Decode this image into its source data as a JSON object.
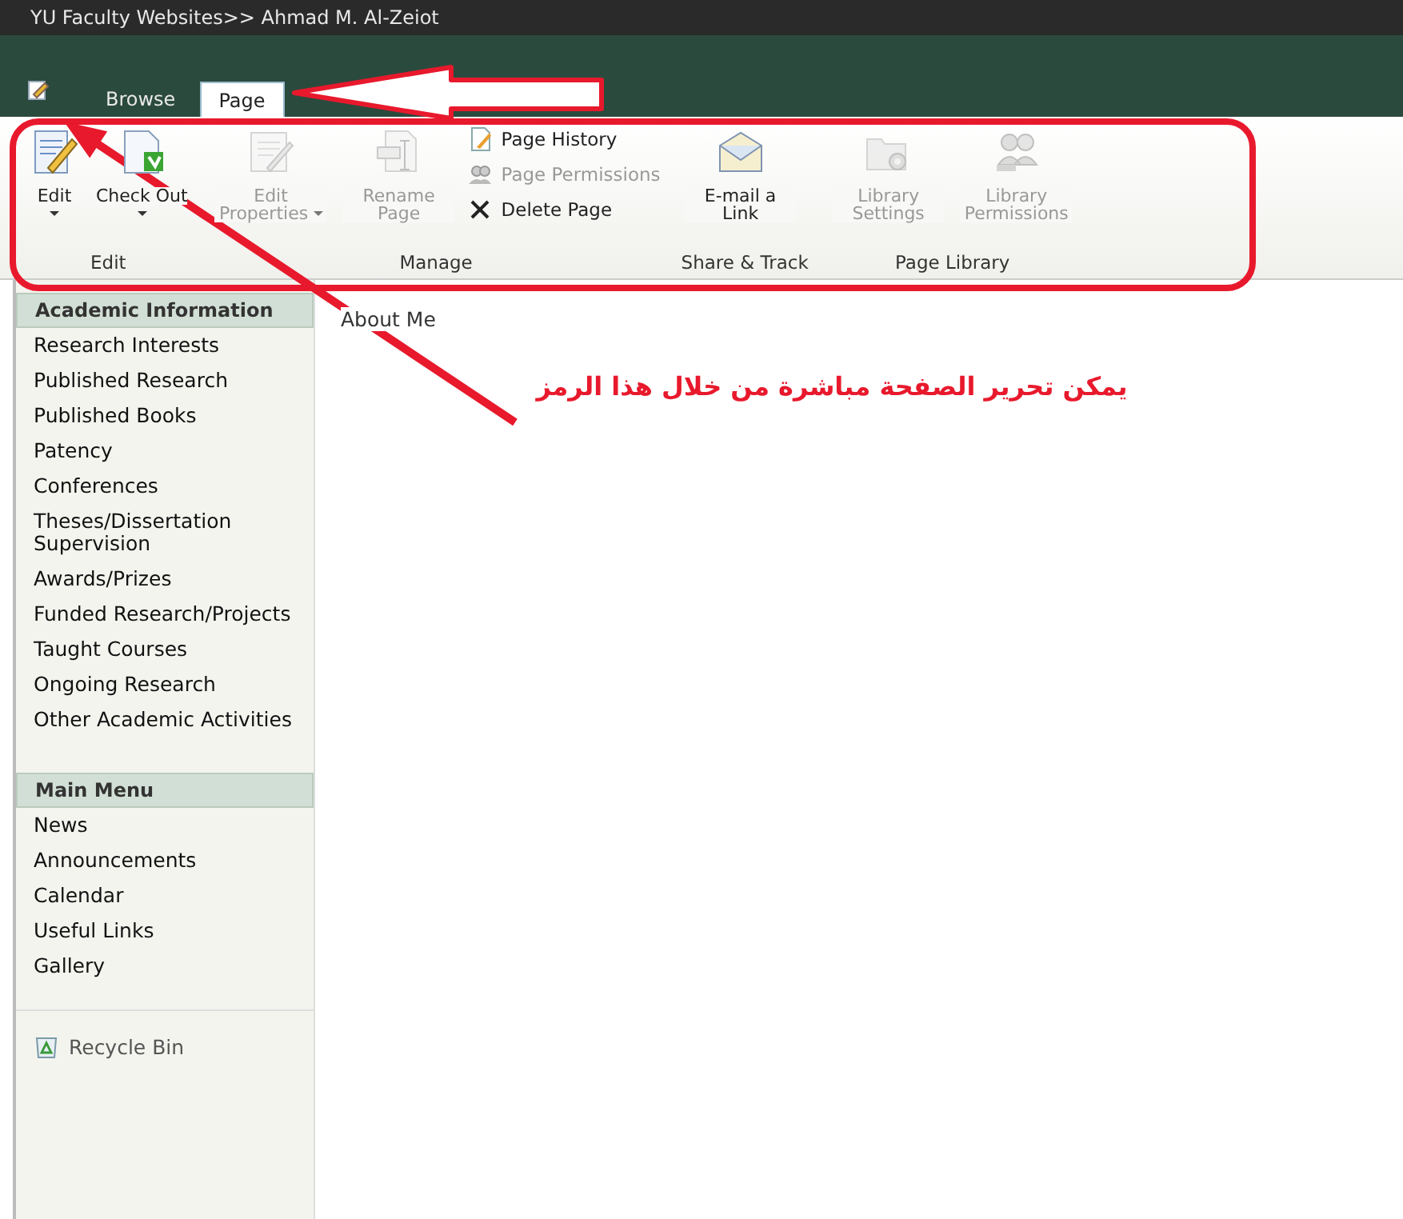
{
  "window": {
    "title": "YU Faculty Websites>> Ahmad M. Al-Zeiot"
  },
  "tabs": [
    {
      "label": "Browse",
      "selected": false
    },
    {
      "label": "Page",
      "selected": true
    }
  ],
  "ribbon": {
    "groups": [
      {
        "label": "Edit",
        "commands": [
          {
            "kind": "large",
            "label": "Edit",
            "disabled": false
          },
          {
            "kind": "large",
            "label": "Check Out",
            "disabled": false
          }
        ]
      },
      {
        "label": "Manage",
        "commands": [
          {
            "kind": "large",
            "label": "Edit Properties",
            "disabled": true
          },
          {
            "kind": "large",
            "label": "Rename Page",
            "disabled": true
          },
          {
            "kind": "stack",
            "items": [
              {
                "label": "Page History",
                "disabled": false
              },
              {
                "label": "Page Permissions",
                "disabled": true
              },
              {
                "label": "Delete Page",
                "disabled": false
              }
            ]
          }
        ]
      },
      {
        "label": "Share & Track",
        "commands": [
          {
            "kind": "large",
            "label": "E-mail a Link",
            "disabled": false
          }
        ]
      },
      {
        "label": "Page Library",
        "commands": [
          {
            "kind": "large",
            "label": "Library Settings",
            "disabled": true
          },
          {
            "kind": "large",
            "label": "Library Permissions",
            "disabled": true
          }
        ]
      }
    ]
  },
  "sidebar": {
    "sections": [
      {
        "heading": "Academic Information",
        "items": [
          "Research Interests",
          "Published Research",
          "Published Books",
          "Patency",
          "Conferences",
          "Theses/Dissertation Supervision",
          "Awards/Prizes",
          "Funded Research/Projects",
          "Taught Courses",
          "Ongoing Research",
          "Other Academic Activities"
        ]
      },
      {
        "heading": "Main Menu",
        "items": [
          "News",
          "Announcements",
          "Calendar",
          "Useful Links",
          "Gallery"
        ]
      }
    ],
    "recycle_bin": "Recycle Bin"
  },
  "content": {
    "title": "About Me"
  },
  "annotation": {
    "text": "يمكن تحرير الصفحة مباشرة من خلال هذا الرمز"
  }
}
